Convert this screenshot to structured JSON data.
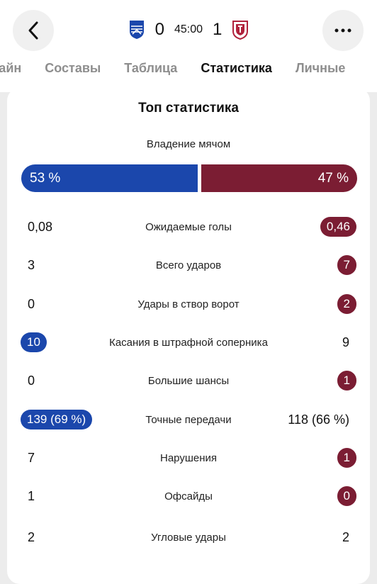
{
  "colors": {
    "home": "#1b47ac",
    "away": "#7b1d33"
  },
  "header": {
    "back_icon": "chevron-left-icon",
    "more_icon": "ellipsis-icon",
    "home_crest": "home-team-crest",
    "away_crest": "away-team-crest",
    "home_goals": "0",
    "away_goals": "1",
    "clock": "45:00"
  },
  "tabs": [
    {
      "label": "нлайн",
      "active": false
    },
    {
      "label": "Составы",
      "active": false
    },
    {
      "label": "Таблица",
      "active": false
    },
    {
      "label": "Статистика",
      "active": true
    },
    {
      "label": "Личные",
      "active": false
    }
  ],
  "card": {
    "title": "Топ статистика",
    "possession": {
      "label": "Владение мячом",
      "home": "53 %",
      "away": "47 %",
      "home_share": 53,
      "away_share": 47
    }
  },
  "stats": [
    {
      "label": "Ожидаемые голы",
      "home": "0,08",
      "away": "0,46",
      "highlight": "away"
    },
    {
      "label": "Всего ударов",
      "home": "3",
      "away": "7",
      "highlight": "away"
    },
    {
      "label": "Удары в створ ворот",
      "home": "0",
      "away": "2",
      "highlight": "away"
    },
    {
      "label": "Касания в штрафной соперника",
      "home": "10",
      "away": "9",
      "highlight": "home"
    },
    {
      "label": "Большие шансы",
      "home": "0",
      "away": "1",
      "highlight": "away"
    },
    {
      "label": "Точные передачи",
      "home": "139 (69 %)",
      "away": "118 (66 %)",
      "highlight": "home"
    },
    {
      "label": "Нарушения",
      "home": "7",
      "away": "1",
      "highlight": "away"
    },
    {
      "label": "Офсайды",
      "home": "1",
      "away": "0",
      "highlight": "away"
    },
    {
      "label": "Угловые удары",
      "home": "2",
      "away": "2",
      "highlight": "none"
    }
  ]
}
